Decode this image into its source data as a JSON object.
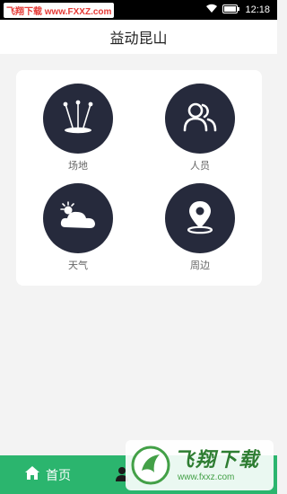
{
  "status_bar": {
    "watermark": "飞翔下载 www.FXXZ.com",
    "time": "12:18",
    "icons": [
      "wifi-icon",
      "battery-icon"
    ]
  },
  "header": {
    "title": "益动昆山"
  },
  "grid": [
    {
      "label": "场地",
      "icon": "stadium-lights-icon"
    },
    {
      "label": "人员",
      "icon": "people-icon"
    },
    {
      "label": "天气",
      "icon": "weather-icon"
    },
    {
      "label": "周边",
      "icon": "location-pin-icon"
    }
  ],
  "tab_bar": {
    "home_label": "首页",
    "home_icon": "home-icon",
    "second_icon": "profile-icon"
  },
  "overlay_watermark": {
    "title": "飞翔下载",
    "url": "www.fxxz.com"
  },
  "colors": {
    "tab_bar": "#2bb56e",
    "icon_circle": "#262a3c",
    "background": "#f3f3f3"
  }
}
